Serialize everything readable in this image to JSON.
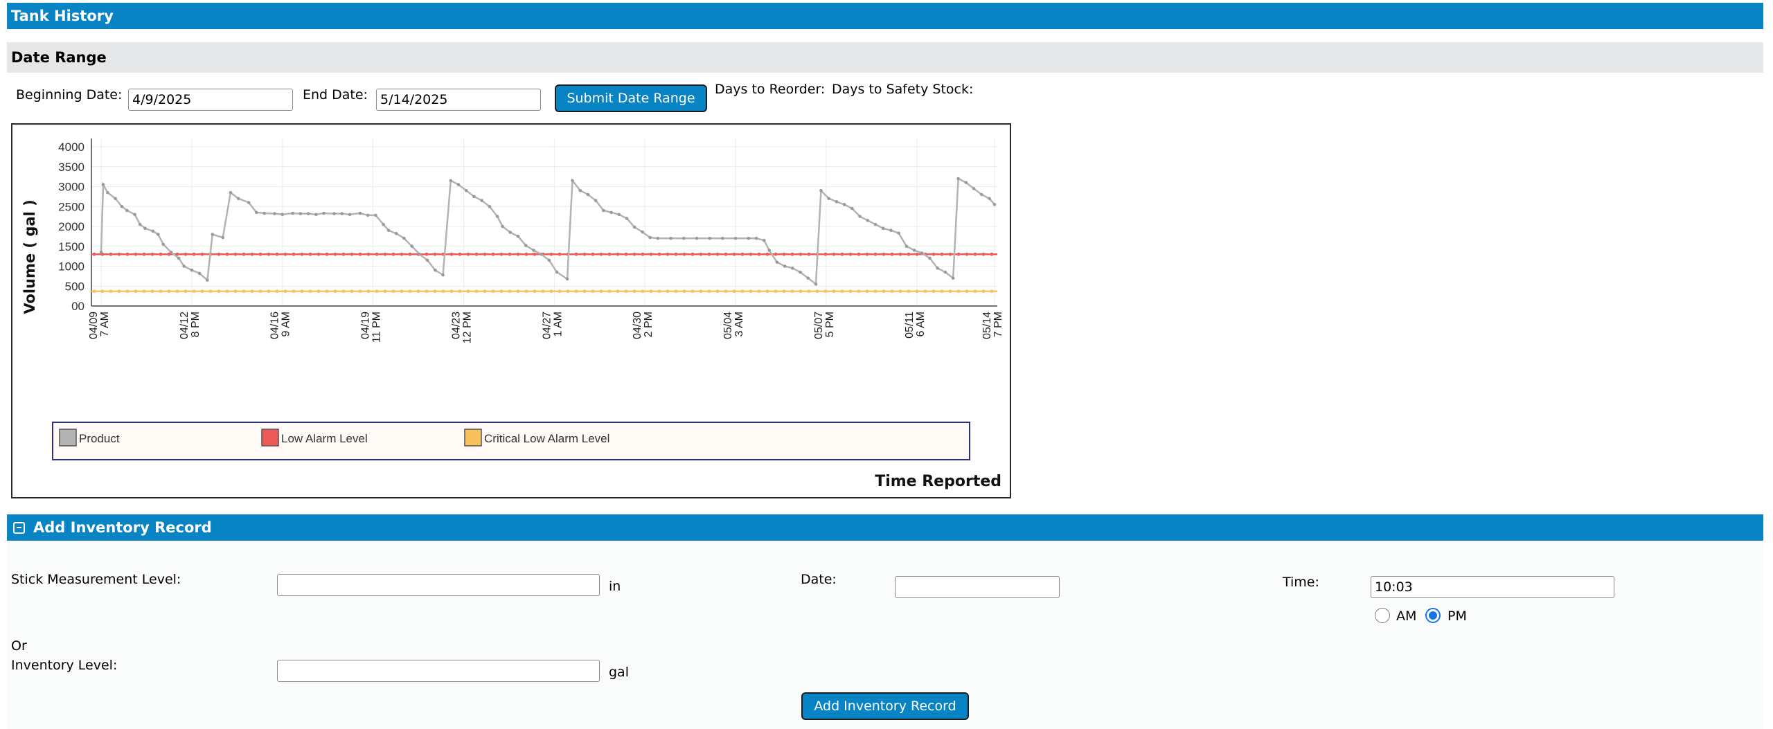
{
  "header": {
    "title": "Tank History"
  },
  "date_range": {
    "title": "Date Range",
    "beginning_label": "Beginning Date:",
    "beginning_value": "4/9/2025",
    "end_label": "End Date:",
    "end_value": "5/14/2025",
    "submit_label": "Submit Date Range",
    "days_to_reorder_label": "Days to Reorder:",
    "days_to_safety_label": "Days to Safety Stock:"
  },
  "chart_data": {
    "type": "line",
    "ylabel": "Volume ( gal )",
    "xlabel": "Time Reported",
    "y_ticks": [
      "4000",
      "3500",
      "3000",
      "2500",
      "2000",
      "1500",
      "1000",
      "500",
      "00"
    ],
    "ylim": [
      0,
      4500
    ],
    "x_ticks": [
      {
        "date": "04/09",
        "time": "7 AM"
      },
      {
        "date": "04/12",
        "time": "8 PM"
      },
      {
        "date": "04/16",
        "time": "9 AM"
      },
      {
        "date": "04/19",
        "time": "11 PM"
      },
      {
        "date": "04/23",
        "time": "12 PM"
      },
      {
        "date": "04/27",
        "time": "1 AM"
      },
      {
        "date": "04/30",
        "time": "2 PM"
      },
      {
        "date": "05/04",
        "time": "3 AM"
      },
      {
        "date": "05/07",
        "time": "5 PM"
      },
      {
        "date": "05/11",
        "time": "6 AM"
      },
      {
        "date": "05/14",
        "time": "7 PM"
      }
    ],
    "grid": true,
    "legend_placement": "bottom",
    "series": [
      {
        "name": "Product",
        "color": "#b3b3b3",
        "points": [
          [
            0,
            1350
          ],
          [
            0.08,
            3050
          ],
          [
            0.25,
            2850
          ],
          [
            0.55,
            2700
          ],
          [
            0.8,
            2500
          ],
          [
            1.0,
            2400
          ],
          [
            1.3,
            2300
          ],
          [
            1.5,
            2050
          ],
          [
            1.7,
            1950
          ],
          [
            2.0,
            1880
          ],
          [
            2.2,
            1800
          ],
          [
            2.4,
            1550
          ],
          [
            2.7,
            1350
          ],
          [
            3.0,
            1200
          ],
          [
            3.2,
            1000
          ],
          [
            3.5,
            900
          ],
          [
            3.8,
            820
          ],
          [
            4.1,
            650
          ],
          [
            4.3,
            1800
          ],
          [
            4.7,
            1720
          ],
          [
            5.0,
            2850
          ],
          [
            5.3,
            2700
          ],
          [
            5.7,
            2600
          ],
          [
            6.0,
            2350
          ],
          [
            6.3,
            2330
          ],
          [
            6.7,
            2320
          ],
          [
            7.0,
            2300
          ],
          [
            7.4,
            2330
          ],
          [
            7.7,
            2320
          ],
          [
            8.0,
            2320
          ],
          [
            8.3,
            2300
          ],
          [
            8.6,
            2330
          ],
          [
            9.0,
            2320
          ],
          [
            9.3,
            2320
          ],
          [
            9.6,
            2300
          ],
          [
            10.0,
            2330
          ],
          [
            10.3,
            2280
          ],
          [
            10.6,
            2280
          ],
          [
            10.9,
            2050
          ],
          [
            11.1,
            1900
          ],
          [
            11.4,
            1820
          ],
          [
            11.7,
            1700
          ],
          [
            12.0,
            1500
          ],
          [
            12.3,
            1300
          ],
          [
            12.6,
            1150
          ],
          [
            12.9,
            900
          ],
          [
            13.2,
            780
          ],
          [
            13.5,
            3150
          ],
          [
            13.8,
            3050
          ],
          [
            14.1,
            2900
          ],
          [
            14.4,
            2750
          ],
          [
            14.7,
            2650
          ],
          [
            15.0,
            2500
          ],
          [
            15.3,
            2250
          ],
          [
            15.5,
            2000
          ],
          [
            15.8,
            1850
          ],
          [
            16.1,
            1750
          ],
          [
            16.4,
            1520
          ],
          [
            16.7,
            1400
          ],
          [
            17.0,
            1300
          ],
          [
            17.3,
            1150
          ],
          [
            17.6,
            850
          ],
          [
            18.0,
            680
          ],
          [
            18.2,
            3150
          ],
          [
            18.5,
            2900
          ],
          [
            18.8,
            2800
          ],
          [
            19.1,
            2650
          ],
          [
            19.4,
            2400
          ],
          [
            19.7,
            2350
          ],
          [
            20.0,
            2300
          ],
          [
            20.3,
            2200
          ],
          [
            20.6,
            1980
          ],
          [
            20.9,
            1860
          ],
          [
            21.2,
            1720
          ],
          [
            21.5,
            1700
          ],
          [
            22.0,
            1700
          ],
          [
            22.5,
            1700
          ],
          [
            23.0,
            1700
          ],
          [
            23.5,
            1700
          ],
          [
            24.0,
            1700
          ],
          [
            24.5,
            1700
          ],
          [
            25.0,
            1700
          ],
          [
            25.3,
            1700
          ],
          [
            25.6,
            1650
          ],
          [
            25.8,
            1400
          ],
          [
            26.1,
            1100
          ],
          [
            26.4,
            1000
          ],
          [
            26.7,
            950
          ],
          [
            27.0,
            850
          ],
          [
            27.3,
            700
          ],
          [
            27.6,
            550
          ],
          [
            27.8,
            2900
          ],
          [
            28.1,
            2700
          ],
          [
            28.4,
            2620
          ],
          [
            28.7,
            2550
          ],
          [
            29.0,
            2450
          ],
          [
            29.3,
            2250
          ],
          [
            29.6,
            2150
          ],
          [
            29.9,
            2050
          ],
          [
            30.2,
            1950
          ],
          [
            30.5,
            1900
          ],
          [
            30.8,
            1830
          ],
          [
            31.1,
            1500
          ],
          [
            31.4,
            1400
          ],
          [
            31.7,
            1330
          ],
          [
            32.0,
            1200
          ],
          [
            32.3,
            950
          ],
          [
            32.6,
            850
          ],
          [
            32.9,
            700
          ],
          [
            33.1,
            3200
          ],
          [
            33.4,
            3100
          ],
          [
            33.7,
            2950
          ],
          [
            34.0,
            2800
          ],
          [
            34.3,
            2700
          ],
          [
            34.5,
            2550
          ]
        ]
      },
      {
        "name": "Low Alarm Level",
        "color": "#ee5a5a",
        "value": 1300
      },
      {
        "name": "Critical Low Alarm Level",
        "color": "#f7c15d",
        "value": 370
      }
    ],
    "x_range": [
      0,
      34.5
    ],
    "x_tick_positions": [
      0,
      3.5,
      7.0,
      10.5,
      14.0,
      17.5,
      21.0,
      24.5,
      28.0,
      31.5,
      34.5
    ]
  },
  "add_record": {
    "title": "Add Inventory Record",
    "collapse_icon": "collapse-minus-icon",
    "stick_label": "Stick Measurement Level:",
    "stick_unit": "in",
    "stick_value": "",
    "date_label": "Date:",
    "date_value": "",
    "time_label": "Time:",
    "time_value": "10:03",
    "am_label": "AM",
    "pm_label": "PM",
    "selected_period": "PM",
    "or_label": "Or",
    "inventory_label": "Inventory Level:",
    "inventory_unit": "gal",
    "inventory_value": "",
    "submit_label": "Add Inventory Record"
  }
}
